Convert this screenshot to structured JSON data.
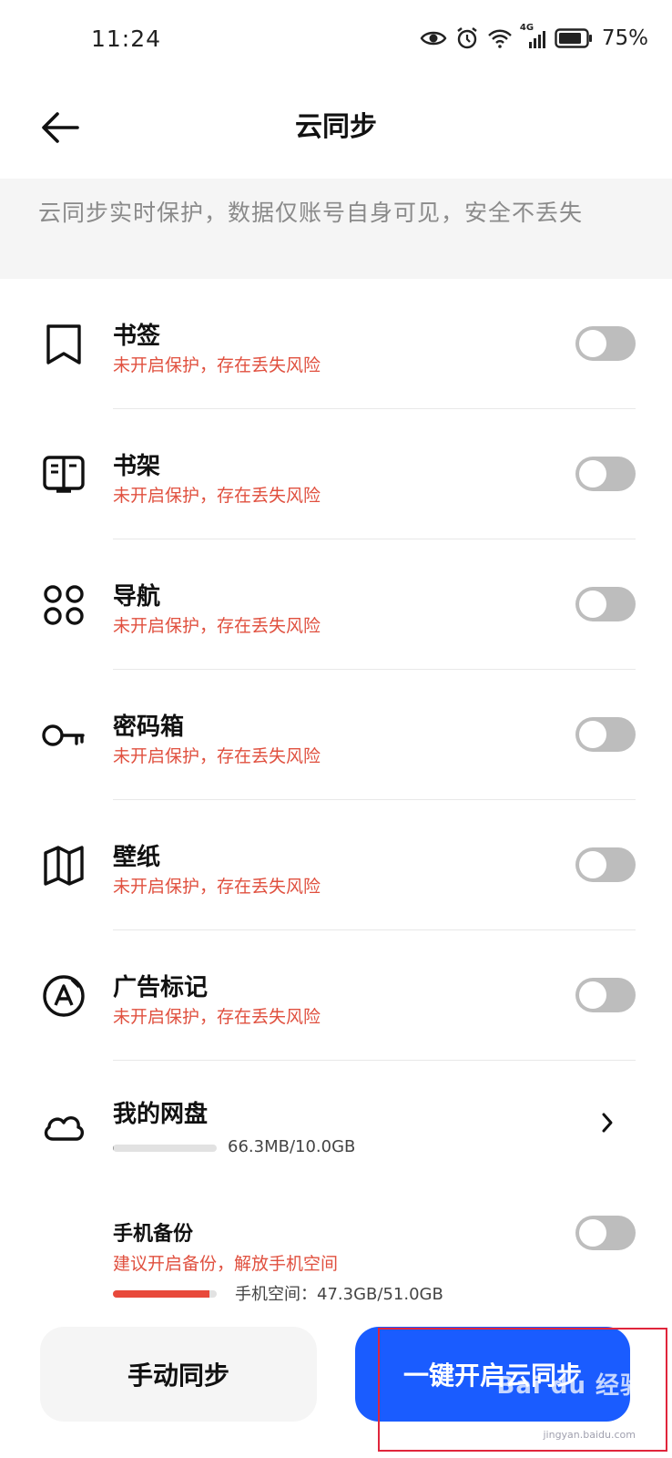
{
  "status_bar": {
    "time": "11:24",
    "battery": "75%",
    "network": "4G",
    "icons": [
      "eye-icon",
      "alarm-icon",
      "wifi-icon",
      "signal-icon",
      "battery-icon"
    ]
  },
  "header": {
    "title": "云同步",
    "back_icon": "arrow-left-icon"
  },
  "notice": {
    "text": "云同步实时保护，数据仅账号自身可见，安全不丢失"
  },
  "sync_items": [
    {
      "title": "书签",
      "subtitle": "未开启保护，存在丢失风险",
      "icon": "bookmark-icon",
      "enabled": false
    },
    {
      "title": "书架",
      "subtitle": "未开启保护，存在丢失风险",
      "icon": "bookshelf-icon",
      "enabled": false
    },
    {
      "title": "导航",
      "subtitle": "未开启保护，存在丢失风险",
      "icon": "grid-dots-icon",
      "enabled": false
    },
    {
      "title": "密码箱",
      "subtitle": "未开启保护，存在丢失风险",
      "icon": "key-icon",
      "enabled": false
    },
    {
      "title": "壁纸",
      "subtitle": "未开启保护，存在丢失风险",
      "icon": "wallpaper-icon",
      "enabled": false
    },
    {
      "title": "广告标记",
      "subtitle": "未开启保护，存在丢失风险",
      "icon": "ad-mark-icon",
      "enabled": false
    }
  ],
  "cloud_drive": {
    "title": "我的网盘",
    "usage": "66.3MB/10.0GB",
    "usage_fraction": 0.0065,
    "icon": "cloud-icon"
  },
  "phone_backup": {
    "title": "手机备份",
    "subtitle": "建议开启备份，解放手机空间",
    "usage_label": "手机空间：47.3GB/51.0GB",
    "usage_fraction": 0.927,
    "enabled": false
  },
  "buttons": {
    "manual_sync": "手动同步",
    "one_click_sync": "一键开启云同步"
  },
  "watermark": {
    "text": "Bai du 经验",
    "subtext": "jingyan.baidu.com"
  },
  "colors": {
    "accent": "#1a5cff",
    "warning": "#e0503f",
    "highlight": "#e0253b"
  }
}
